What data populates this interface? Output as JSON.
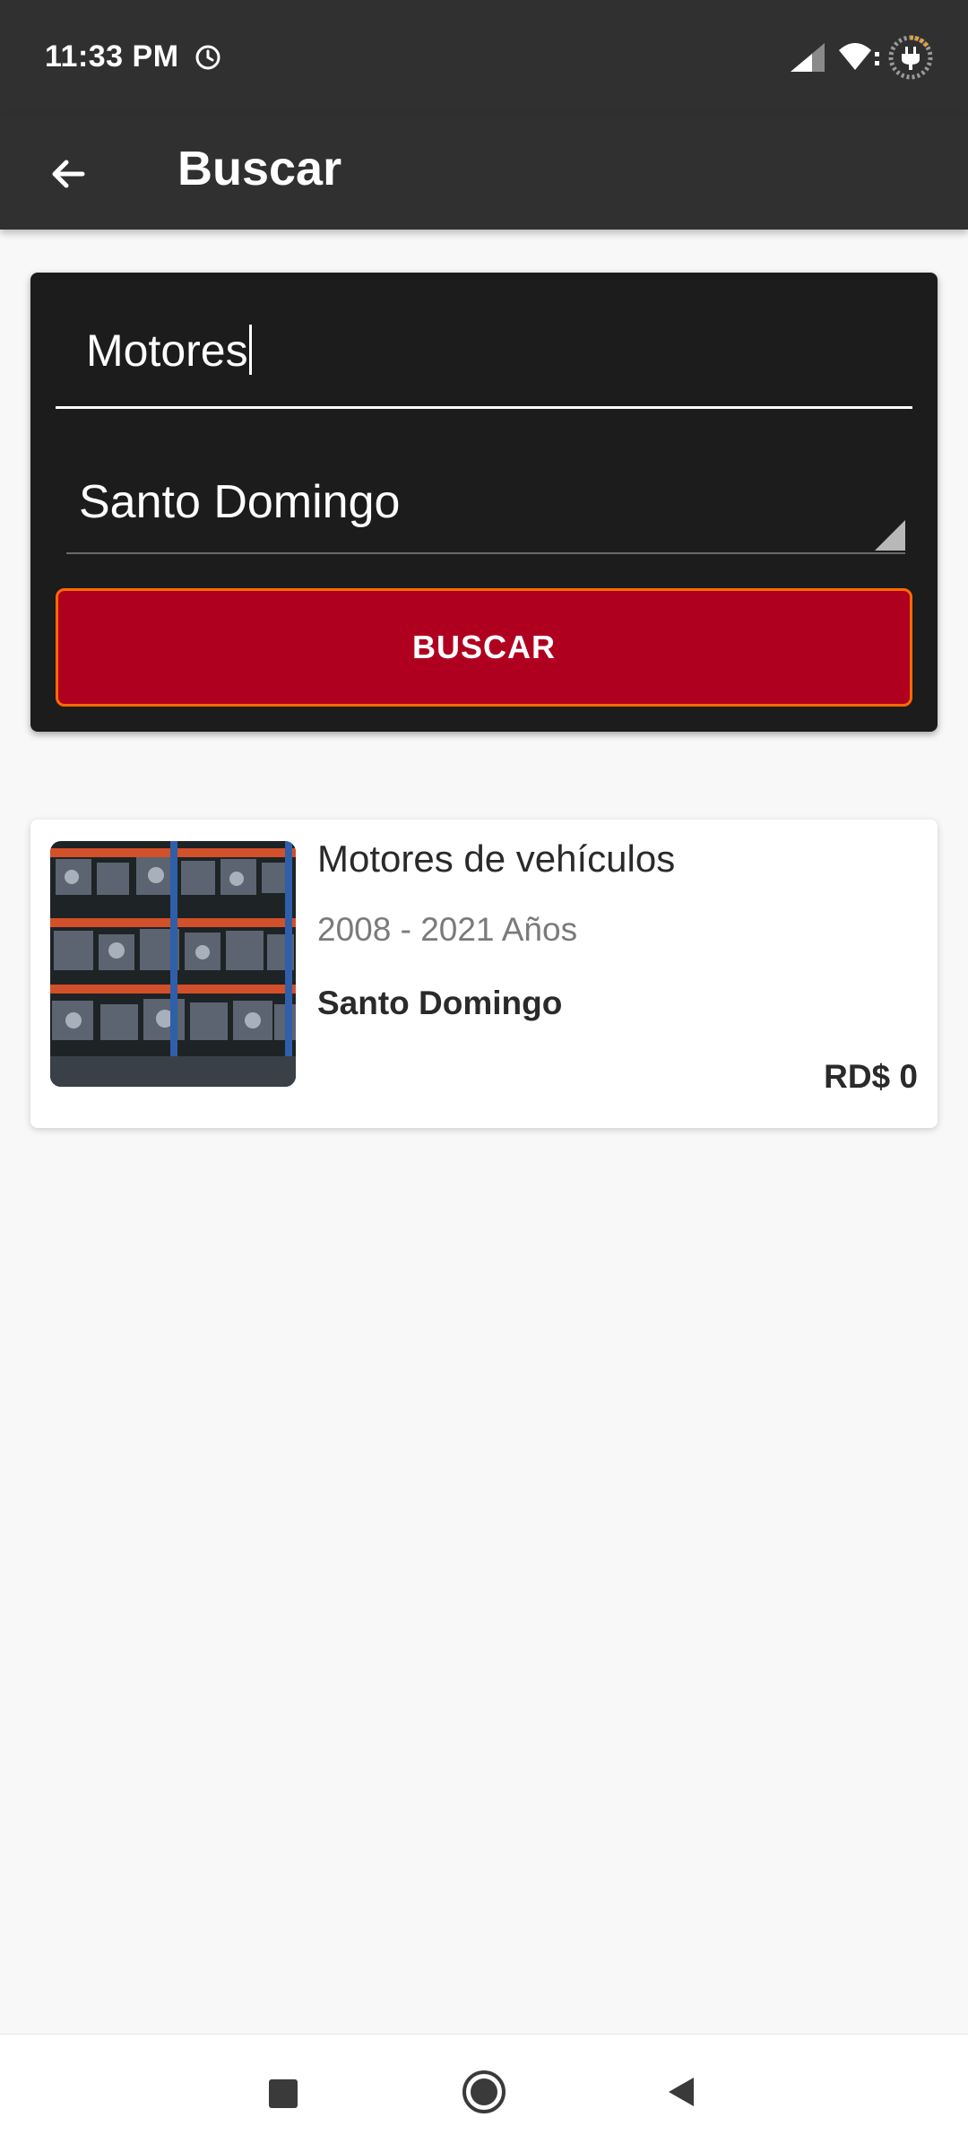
{
  "status_bar": {
    "time": "11:33 PM",
    "icons": [
      "alarm-icon",
      "cell-signal-icon",
      "wifi-icon",
      "battery-charging-icon"
    ]
  },
  "app_bar": {
    "title": "Buscar",
    "back_icon": "arrow-back-icon"
  },
  "search": {
    "query_value": "Motores",
    "location_value": "Santo Domingo",
    "button_label": "BUSCAR"
  },
  "results": [
    {
      "title": "Motores de vehículos",
      "years": "2008 - 2021 Años",
      "location": "Santo Domingo",
      "price": "RD$ 0"
    }
  ],
  "nav_bar": {
    "icons": [
      "recents-icon",
      "home-icon",
      "back-icon"
    ]
  },
  "colors": {
    "bar": "#303030",
    "card_dark": "#1c1c1c",
    "button": "#b00020",
    "button_border": "#ff6a00",
    "background": "#f8f8f8"
  }
}
